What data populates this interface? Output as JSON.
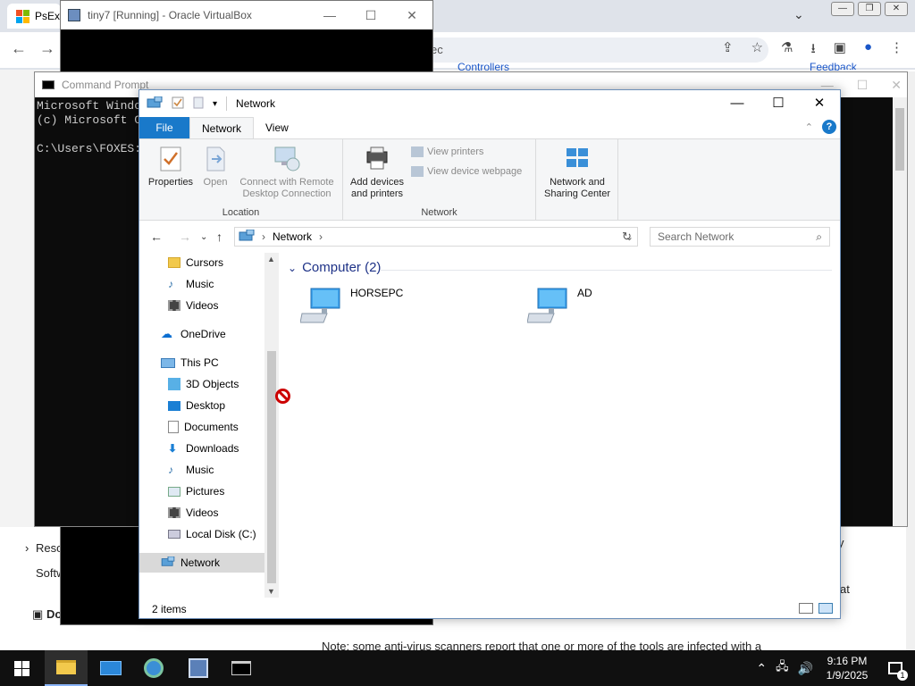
{
  "browser": {
    "tab_title": "PsEx",
    "omnibox_text": "ec",
    "crumb_left": "Controllers",
    "crumb_right": "Feedback",
    "page_lines": [
      "Reso",
      "Softw",
      "Do",
      "Note: some anti-virus scanners report that one or more of the tools are infected with a"
    ],
    "right_fragments": [
      "y",
      "at"
    ]
  },
  "vbox": {
    "title": "tiny7 [Running] - Oracle VirtualBox"
  },
  "cmd": {
    "title": "Command Prompt",
    "lines": [
      "Microsoft Windo",
      "(c) Microsoft C",
      "",
      "C:\\Users\\FOXES:"
    ]
  },
  "explorer": {
    "title": "Network",
    "tabs": {
      "file": "File",
      "network": "Network",
      "view": "View"
    },
    "ribbon": {
      "location": {
        "label": "Location",
        "properties": "Properties",
        "open": "Open",
        "connect_line1": "Connect with Remote",
        "connect_line2": "Desktop Connection"
      },
      "network": {
        "label": "Network",
        "add_line1": "Add devices",
        "add_line2": "and printers",
        "view_printers": "View printers",
        "view_device_webpage": "View device webpage",
        "nsc_line1": "Network and",
        "nsc_line2": "Sharing Center"
      }
    },
    "address": {
      "crumb": "Network"
    },
    "search_placeholder": "Search Network",
    "nav": {
      "cursors": "Cursors",
      "music": "Music",
      "videos": "Videos",
      "onedrive": "OneDrive",
      "thispc": "This PC",
      "objects3d": "3D Objects",
      "desktop": "Desktop",
      "documents": "Documents",
      "downloads": "Downloads",
      "music2": "Music",
      "pictures": "Pictures",
      "videos2": "Videos",
      "localdisk": "Local Disk (C:)",
      "network": "Network"
    },
    "group_title": "Computer (2)",
    "computers": [
      "HORSEPC",
      "AD"
    ],
    "status": "2 items"
  },
  "taskbar": {
    "time": "9:16 PM",
    "date": "1/9/2025",
    "notification_count": "1"
  },
  "colors": {
    "accent": "#1979ca",
    "group_heading": "#1e3287",
    "taskbar": "#101010"
  }
}
